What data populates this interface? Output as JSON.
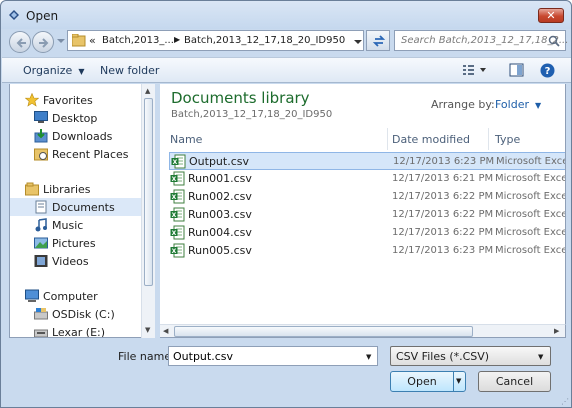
{
  "window": {
    "title": "Open",
    "close_label": "✕"
  },
  "address_bar": {
    "chevron": "«",
    "segment_1": "Batch,2013_...",
    "separator": "▶",
    "segment_2": "Batch,2013_12_17,18_20_ID950"
  },
  "search": {
    "placeholder": "Search Batch,2013_12_17,18_2..."
  },
  "toolbar": {
    "organize_label": "Organize",
    "new_folder_label": "New folder"
  },
  "nav_pane": {
    "favorites_label": "Favorites",
    "favorites_items": [
      "Desktop",
      "Downloads",
      "Recent Places"
    ],
    "libraries_label": "Libraries",
    "libraries_items": [
      "Documents",
      "Music",
      "Pictures",
      "Videos"
    ],
    "selected_item": "Documents",
    "computer_label": "Computer",
    "computer_items": [
      "OSDisk (C:)",
      "Lexar (E:)"
    ]
  },
  "content": {
    "library_title": "Documents library",
    "library_subtitle": "Batch,2013_12_17,18_20_ID950",
    "arrange_by_label": "Arrange by:",
    "arrange_by_value": "Folder"
  },
  "columns": {
    "name": "Name",
    "date_modified": "Date modified",
    "type": "Type"
  },
  "files": [
    {
      "name": "Output.csv",
      "date": "12/17/2013 6:23 PM",
      "type": "Microsoft Excel"
    },
    {
      "name": "Run001.csv",
      "date": "12/17/2013 6:21 PM",
      "type": "Microsoft Excel"
    },
    {
      "name": "Run002.csv",
      "date": "12/17/2013 6:22 PM",
      "type": "Microsoft Excel"
    },
    {
      "name": "Run003.csv",
      "date": "12/17/2013 6:22 PM",
      "type": "Microsoft Excel"
    },
    {
      "name": "Run004.csv",
      "date": "12/17/2013 6:22 PM",
      "type": "Microsoft Excel"
    },
    {
      "name": "Run005.csv",
      "date": "12/17/2013 6:23 PM",
      "type": "Microsoft Excel"
    }
  ],
  "selected_file": "Output.csv",
  "file_name": {
    "label": "File name:",
    "value": "Output.csv"
  },
  "file_type": {
    "selected": "CSV Files (*.CSV)"
  },
  "buttons": {
    "open_label": "Open",
    "cancel_label": "Cancel"
  },
  "colors": {
    "library_title": "#1d6c2d",
    "selection": "#d5e6f9",
    "frame": "#c9daee",
    "close_button": "#c8482f"
  },
  "icons": {
    "file_icon": "excel-csv-icon",
    "favorites_icon": "star-icon",
    "libraries_icon": "library-icon",
    "computer_icon": "computer-icon"
  }
}
